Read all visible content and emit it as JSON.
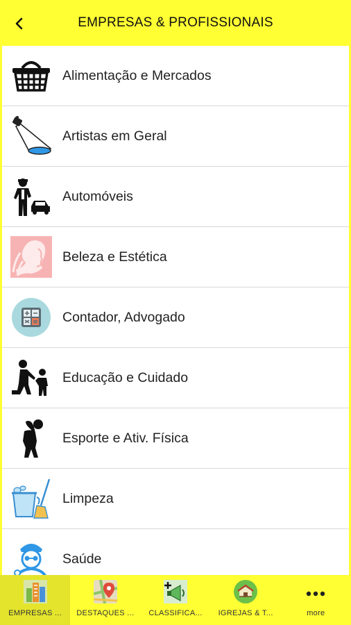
{
  "header": {
    "title": "EMPRESAS & PROFISSIONAIS",
    "back_icon": "chevron-left-icon"
  },
  "categories": [
    {
      "label": "Alimentação e Mercados",
      "icon": "basket-icon"
    },
    {
      "label": "Artistas em Geral",
      "icon": "spotlight-icon"
    },
    {
      "label": "Automóveis",
      "icon": "car-attendant-icon"
    },
    {
      "label": "Beleza e Estética",
      "icon": "woman-profile-icon"
    },
    {
      "label": "Contador, Advogado",
      "icon": "calculator-icon"
    },
    {
      "label": "Educação e Cuidado",
      "icon": "adult-child-icon"
    },
    {
      "label": "Esporte e Ativ. Física",
      "icon": "stretching-person-icon"
    },
    {
      "label": "Limpeza",
      "icon": "bucket-broom-icon"
    },
    {
      "label": "Saúde",
      "icon": "nurse-icon"
    }
  ],
  "tabbar": {
    "tabs": [
      {
        "label": "EMPRESAS ...",
        "icon": "buildings-icon",
        "active": true
      },
      {
        "label": "DESTAQUES ...",
        "icon": "map-pin-icon",
        "active": false
      },
      {
        "label": "CLASSIFICA...",
        "icon": "megaphone-icon",
        "active": false
      },
      {
        "label": "IGREJAS & T...",
        "icon": "church-icon",
        "active": false
      },
      {
        "label": "more",
        "icon": "more-dots-icon",
        "active": false
      }
    ]
  },
  "colors": {
    "accent": "#ffff33",
    "active_tab": "#e4e42c",
    "list_background": "#ffffff",
    "divider": "#d8d8d8"
  }
}
